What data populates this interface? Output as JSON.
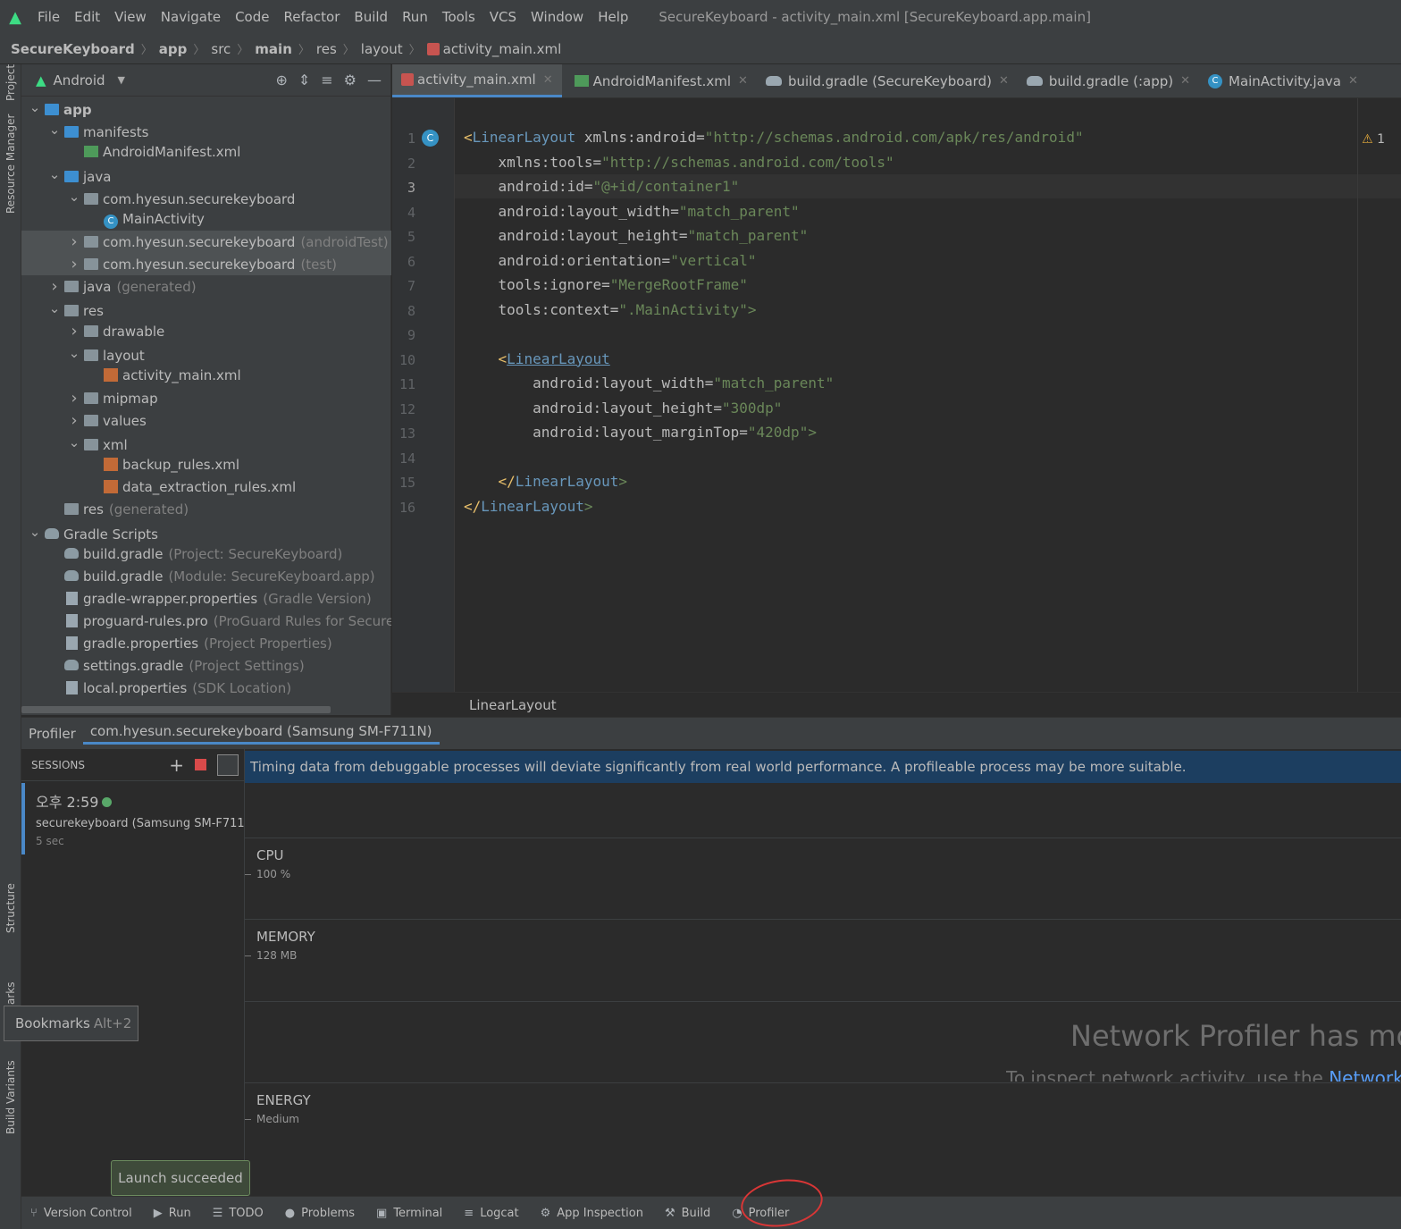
{
  "menubar": {
    "items": [
      "File",
      "Edit",
      "View",
      "Navigate",
      "Code",
      "Refactor",
      "Build",
      "Run",
      "Tools",
      "VCS",
      "Window",
      "Help"
    ],
    "window_title": "SecureKeyboard - activity_main.xml [SecureKeyboard.app.main]"
  },
  "breadcrumb": [
    "SecureKeyboard",
    "app",
    "src",
    "main",
    "res",
    "layout",
    "activity_main.xml"
  ],
  "left_stripe": {
    "project": "Project",
    "resource_manager": "Resource Manager",
    "structure": "Structure",
    "bookmarks": "arks",
    "build_variants": "Build Variants"
  },
  "project_panel": {
    "view_selector": "Android",
    "tree": [
      {
        "label": "app",
        "extra": ""
      },
      {
        "label": "manifests",
        "extra": ""
      },
      {
        "label": "AndroidManifest.xml",
        "extra": ""
      },
      {
        "label": "java",
        "extra": ""
      },
      {
        "label": "com.hyesun.securekeyboard",
        "extra": ""
      },
      {
        "label": "MainActivity",
        "extra": ""
      },
      {
        "label": "com.hyesun.securekeyboard",
        "extra": "(androidTest)"
      },
      {
        "label": "com.hyesun.securekeyboard",
        "extra": "(test)"
      },
      {
        "label": "java",
        "extra": "(generated)"
      },
      {
        "label": "res",
        "extra": ""
      },
      {
        "label": "drawable",
        "extra": ""
      },
      {
        "label": "layout",
        "extra": ""
      },
      {
        "label": "activity_main.xml",
        "extra": ""
      },
      {
        "label": "mipmap",
        "extra": ""
      },
      {
        "label": "values",
        "extra": ""
      },
      {
        "label": "xml",
        "extra": ""
      },
      {
        "label": "backup_rules.xml",
        "extra": ""
      },
      {
        "label": "data_extraction_rules.xml",
        "extra": ""
      },
      {
        "label": "res",
        "extra": "(generated)"
      },
      {
        "label": "Gradle Scripts",
        "extra": ""
      },
      {
        "label": "build.gradle",
        "extra": "(Project: SecureKeyboard)"
      },
      {
        "label": "build.gradle",
        "extra": "(Module: SecureKeyboard.app)"
      },
      {
        "label": "gradle-wrapper.properties",
        "extra": "(Gradle Version)"
      },
      {
        "label": "proguard-rules.pro",
        "extra": "(ProGuard Rules for SecureKey"
      },
      {
        "label": "gradle.properties",
        "extra": "(Project Properties)"
      },
      {
        "label": "settings.gradle",
        "extra": "(Project Settings)"
      },
      {
        "label": "local.properties",
        "extra": "(SDK Location)"
      }
    ]
  },
  "editor_tabs": [
    "activity_main.xml",
    "AndroidManifest.xml",
    "build.gradle (SecureKeyboard)",
    "build.gradle (:app)",
    "MainActivity.java"
  ],
  "editor": {
    "line_numbers": [
      "1",
      "2",
      "3",
      "4",
      "5",
      "6",
      "7",
      "8",
      "9",
      "10",
      "11",
      "12",
      "13",
      "14",
      "15",
      "16"
    ],
    "lines": [
      {
        "t": "<",
        "n": "LinearLayout",
        "a": " xmlns:android=",
        "v": "\"http://schemas.android.com/apk/res/android\""
      },
      {
        "t": "    ",
        "n": "",
        "a": "xmlns:tools=",
        "v": "\"http://schemas.android.com/tools\""
      },
      {
        "t": "    ",
        "n": "",
        "a": "android:id=",
        "v": "\"@+id/container1\""
      },
      {
        "t": "    ",
        "n": "",
        "a": "android:layout_width=",
        "v": "\"match_parent\""
      },
      {
        "t": "    ",
        "n": "",
        "a": "android:layout_height=",
        "v": "\"match_parent\""
      },
      {
        "t": "    ",
        "n": "",
        "a": "android:orientation=",
        "v": "\"vertical\""
      },
      {
        "t": "    ",
        "n": "",
        "a": "tools:ignore=",
        "v": "\"MergeRootFrame\""
      },
      {
        "t": "    ",
        "n": "",
        "a": "tools:context=",
        "v": "\".MainActivity\">"
      },
      {
        "t": "",
        "n": "",
        "a": "",
        "v": ""
      },
      {
        "t": "    <",
        "n": "LinearLayout",
        "a": "",
        "v": ""
      },
      {
        "t": "        ",
        "n": "",
        "a": "android:layout_width=",
        "v": "\"match_parent\""
      },
      {
        "t": "        ",
        "n": "",
        "a": "android:layout_height=",
        "v": "\"300dp\""
      },
      {
        "t": "        ",
        "n": "",
        "a": "android:layout_marginTop=",
        "v": "\"420dp\">"
      },
      {
        "t": "",
        "n": "",
        "a": "",
        "v": ""
      },
      {
        "t": "    </",
        "n": "LinearLayout",
        "a": "",
        "v": ">"
      },
      {
        "t": "</",
        "n": "LinearLayout",
        "a": "",
        "v": ">"
      }
    ],
    "warning_count": "1",
    "footer_crumb": "LinearLayout"
  },
  "profiler": {
    "tabs": [
      "Profiler",
      "com.hyesun.securekeyboard (Samsung SM-F711N)"
    ],
    "sessions_label": "SESSIONS",
    "session": {
      "time": "오후 2:59",
      "name": "securekeyboard (Samsung SM-F711...",
      "duration": "5 sec"
    },
    "banner": "Timing data from debuggable processes will deviate significantly from real world performance. A profileable process may be more suitable.",
    "lanes": [
      {
        "title": "CPU",
        "sub": "100 %"
      },
      {
        "title": "MEMORY",
        "sub": "128 MB"
      },
      {
        "title": "ENERGY",
        "sub": "Medium"
      }
    ],
    "network_title": "Network Profiler has mov",
    "network_sub": "To inspect network activity, use the ",
    "network_link": "Network"
  },
  "bookmarks_popup": {
    "label": "Bookmarks",
    "shortcut": "Alt+2"
  },
  "launch_toast": "Launch succeeded",
  "bottom_toolbar": [
    "Version Control",
    "Run",
    "TODO",
    "Problems",
    "Terminal",
    "Logcat",
    "App Inspection",
    "Build",
    "Profiler"
  ]
}
